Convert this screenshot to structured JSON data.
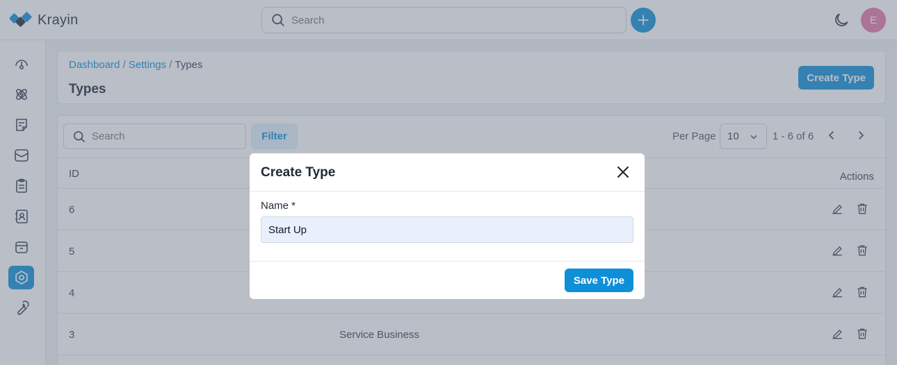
{
  "app": {
    "name": "Krayin"
  },
  "topbar": {
    "search_placeholder": "Search",
    "avatar_initial": "E"
  },
  "sidebar": {
    "items": [
      {
        "icon": "dashboard-gauge-icon"
      },
      {
        "icon": "leads-icon"
      },
      {
        "icon": "quotes-icon"
      },
      {
        "icon": "mail-icon"
      },
      {
        "icon": "activities-icon"
      },
      {
        "icon": "contacts-icon"
      },
      {
        "icon": "products-icon"
      },
      {
        "icon": "settings-icon",
        "active": true
      },
      {
        "icon": "wrench-icon"
      }
    ]
  },
  "header": {
    "breadcrumb": [
      "Dashboard",
      "Settings",
      "Types"
    ],
    "breadcrumb_separator": "/",
    "title": "Types",
    "create_button": "Create Type"
  },
  "table": {
    "search_placeholder": "Search",
    "filter_button": "Filter",
    "per_page_label": "Per Page",
    "per_page_value": "10",
    "range_text": "1 - 6 of 6",
    "columns": {
      "id": "ID",
      "actions": "Actions"
    },
    "rows": [
      {
        "id": "6",
        "name": ""
      },
      {
        "id": "5",
        "name": ""
      },
      {
        "id": "4",
        "name": ""
      },
      {
        "id": "3",
        "name": "Service Business"
      }
    ]
  },
  "modal": {
    "title": "Create Type",
    "field_label": "Name *",
    "field_value": "Start Up",
    "save_button": "Save Type"
  },
  "colors": {
    "accent": "#0e90d9",
    "avatar": "#e879a8"
  }
}
